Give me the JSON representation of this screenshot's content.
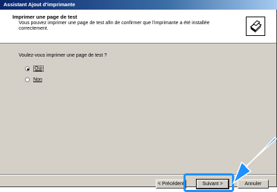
{
  "window": {
    "title": "Assistant Ajout d'imprimante"
  },
  "header": {
    "heading": "Imprimer une page de test",
    "description": "Vous pouvez imprimer une page de test afin de confirmer que l'imprimante a été installée correctement."
  },
  "content": {
    "question": "Voulez-vous imprimer une page de test ?",
    "options": [
      {
        "label": "Oui",
        "selected": true
      },
      {
        "label": "Non",
        "selected": false
      }
    ]
  },
  "buttons": {
    "back": "< Précédent",
    "next": "Suivant >",
    "cancel": "Annuler"
  },
  "colors": {
    "highlight": "#1e90ff",
    "titlebar": "#0a246a"
  },
  "icons": {
    "header": "printer-icon",
    "pointer": "arrow-icon"
  }
}
